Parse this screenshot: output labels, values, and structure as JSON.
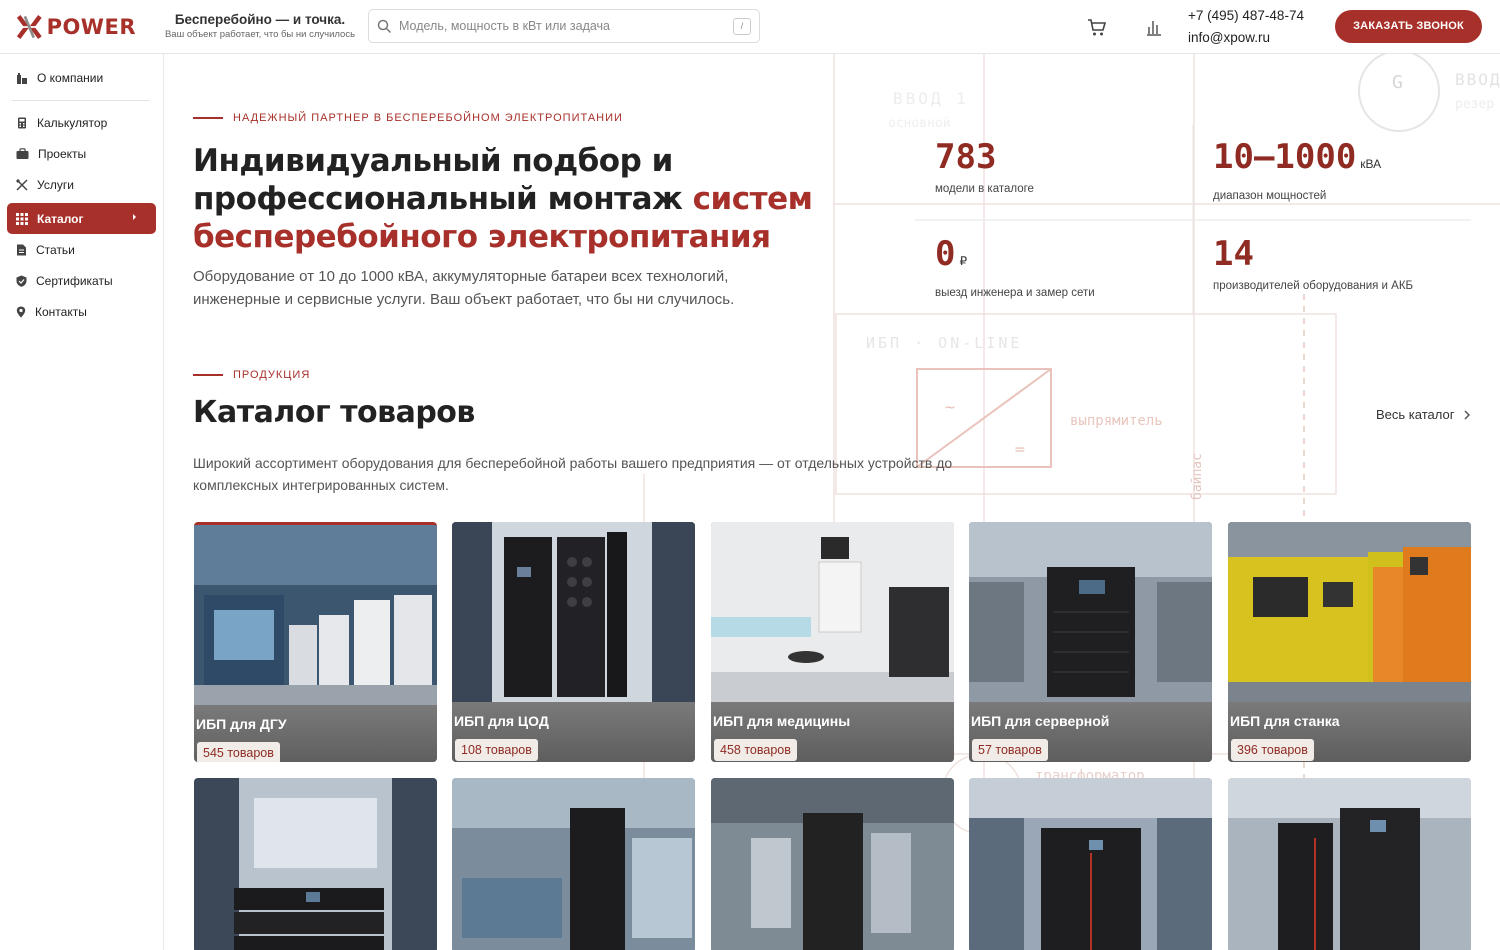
{
  "brand": {
    "logo_text": "POWER",
    "accent_color": "#a8302a"
  },
  "header": {
    "tagline_title": "Бесперебойно — и точка.",
    "tagline_sub": "Ваш объект работает, что бы ни случилось",
    "search_placeholder": "Модель, мощность в кВт или задача",
    "search_shortcut": "/",
    "phone": "+7 (495) 487-48-74",
    "email": "info@xpow.ru",
    "callback_label": "ЗАКАЗАТЬ ЗВОНОК"
  },
  "sidebar": {
    "items": [
      {
        "label": "О компании",
        "icon": "building-icon"
      },
      {
        "label": "Калькулятор",
        "icon": "calculator-icon"
      },
      {
        "label": "Проекты",
        "icon": "briefcase-icon"
      },
      {
        "label": "Услуги",
        "icon": "tools-icon"
      },
      {
        "label": "Каталог",
        "icon": "grid-icon",
        "active": true
      },
      {
        "label": "Статьи",
        "icon": "document-icon"
      },
      {
        "label": "Сертификаты",
        "icon": "shield-icon"
      },
      {
        "label": "Контакты",
        "icon": "location-pin-icon"
      }
    ]
  },
  "hero": {
    "eyebrow": "НАДЕЖНЫЙ ПАРТНЕР В БЕСПЕРЕБОЙНОМ ЭЛЕКТРОПИТАНИИ",
    "title_part1": "Индивидуальный подбор и профессиональный монтаж ",
    "title_accent": "систем бесперебойного электропитания",
    "lead": "Оборудование от 10 до 1000 кВА, аккумуляторные батареи всех технологий, инженерные и сервисные услуги. Ваш объект работает, что бы ни случилось."
  },
  "stats": [
    {
      "value": "783",
      "unit": "",
      "label": "модели в каталоге"
    },
    {
      "value": "10–1000",
      "unit": "кВА",
      "label": "диапазон мощностей"
    },
    {
      "value": "0",
      "unit": "₽",
      "label": "выезд инженера и замер сети"
    },
    {
      "value": "14",
      "unit": "",
      "label": "производителей оборудования и АКБ"
    }
  ],
  "background_text": {
    "input1": "ВВОД 1",
    "main": "основной",
    "input_right": "ВВОД",
    "reserve": "резер",
    "g_label": "G",
    "ups_online": "ИБП · ON-LINE",
    "rectifier": "выпрямитель",
    "transformer": "трансформатор",
    "bypass": "байпас"
  },
  "catalog": {
    "eyebrow": "ПРОДУКЦИЯ",
    "title": "Каталог товаров",
    "all_link": "Весь каталог",
    "description": "Широкий ассортимент оборудования для бесперебойной работы вашего предприятия — от отдельных устройств до комплексных интегрированных систем.",
    "cards": [
      {
        "title": "ИБП для ДГУ",
        "count": "545 товаров"
      },
      {
        "title": "ИБП для ЦОД",
        "count": "108 товаров"
      },
      {
        "title": "ИБП для медицины",
        "count": "458 товаров"
      },
      {
        "title": "ИБП для серверной",
        "count": "57 товаров"
      },
      {
        "title": "ИБП для станка",
        "count": "396 товаров"
      }
    ]
  }
}
